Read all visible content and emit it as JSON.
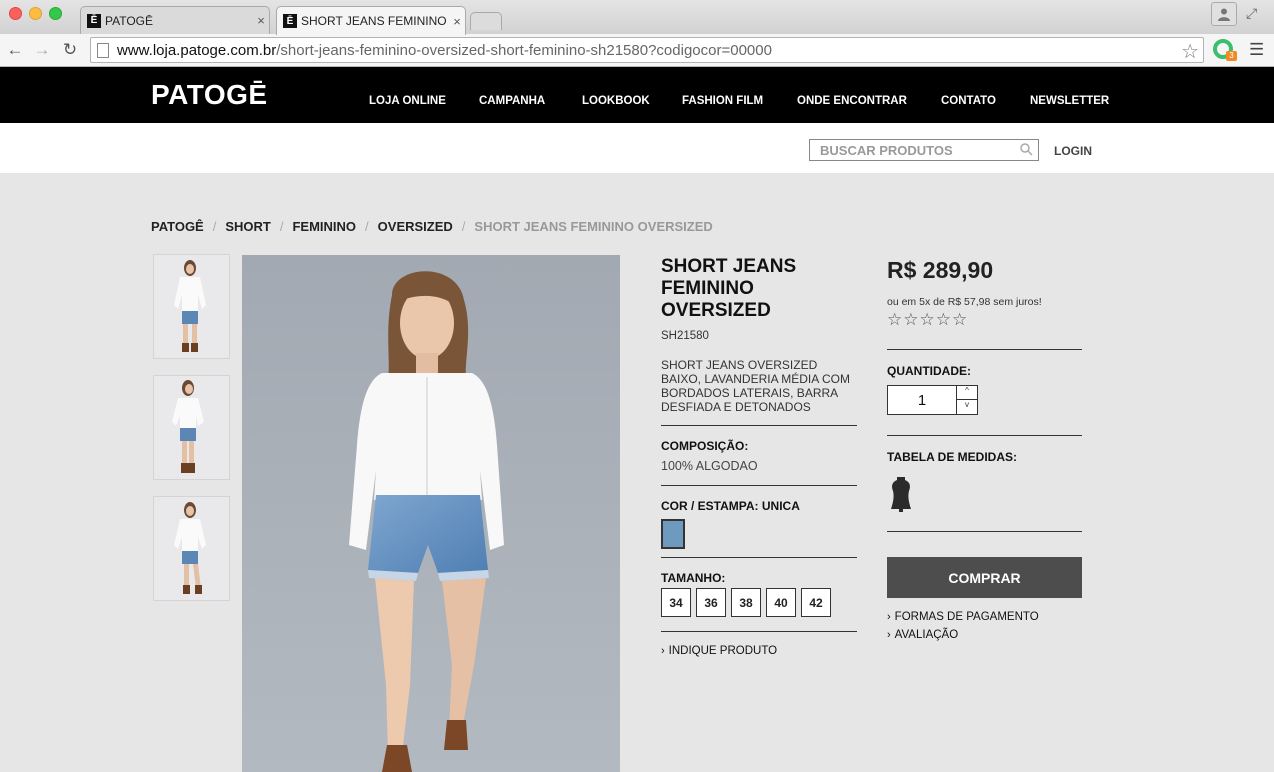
{
  "browser": {
    "tabs": [
      {
        "favicon": "Ē",
        "title": "PATOGĒ"
      },
      {
        "favicon": "Ē",
        "title": "SHORT JEANS FEMININO OVERSIZED"
      }
    ],
    "close_glyph": "×",
    "url_domain": "www.loja.patoge.com.br",
    "url_path": "/short-jeans-feminino-oversized-short-feminino-sh21580?codigocor=00000",
    "extension_badge": "3",
    "icons": [
      "back-icon",
      "forward-icon",
      "reload-icon",
      "star-icon",
      "menu-icon",
      "profile-icon",
      "fullscreen-icon"
    ]
  },
  "header": {
    "logo": "PATOGĒ",
    "nav": [
      "LOJA ONLINE",
      "CAMPANHA",
      "LOOKBOOK",
      "FASHION FILM",
      "ONDE ENCONTRAR",
      "CONTATO",
      "NEWSLETTER"
    ]
  },
  "utility": {
    "search_placeholder": "BUSCAR PRODUTOS",
    "login": "LOGIN"
  },
  "breadcrumb": {
    "items": [
      "PATOGÊ",
      "SHORT",
      "FEMININO",
      "OVERSIZED"
    ],
    "separator": "/",
    "current": "SHORT JEANS FEMININO OVERSIZED"
  },
  "product": {
    "title": "SHORT JEANS FEMININO OVERSIZED",
    "sku": "SH21580",
    "description": "SHORT JEANS OVERSIZED BAIXO, LAVANDERIA MÉDIA COM BORDADOS LATERAIS, BARRA DESFIADA E DETONADOS",
    "composition_label": "COMPOSIÇÃO:",
    "composition_value": "100% ALGODAO",
    "color_label": "COR / ESTAMPA: UNICA",
    "color_swatch": "#6f9ac0",
    "size_label": "TAMANHO:",
    "sizes": [
      "34",
      "36",
      "38",
      "40",
      "42"
    ],
    "indicate_link": "INDIQUE PRODUTO"
  },
  "purchase": {
    "price": "R$ 289,90",
    "installments": "ou em 5x de R$ 57,98 sem juros!",
    "rating_stars": 0,
    "rating_max": 5,
    "quantity_label": "QUANTIDADE:",
    "quantity": "1",
    "size_table_label": "TABELA DE MEDIDAS:",
    "buy_button": "COMPRAR",
    "payment_link": "FORMAS DE PAGAMENTO",
    "review_link": "AVALIAÇÃO"
  },
  "colors": {
    "header_bg": "#000000",
    "page_bg": "#e6e6e6",
    "buy_button_bg": "#4d4d4d"
  }
}
